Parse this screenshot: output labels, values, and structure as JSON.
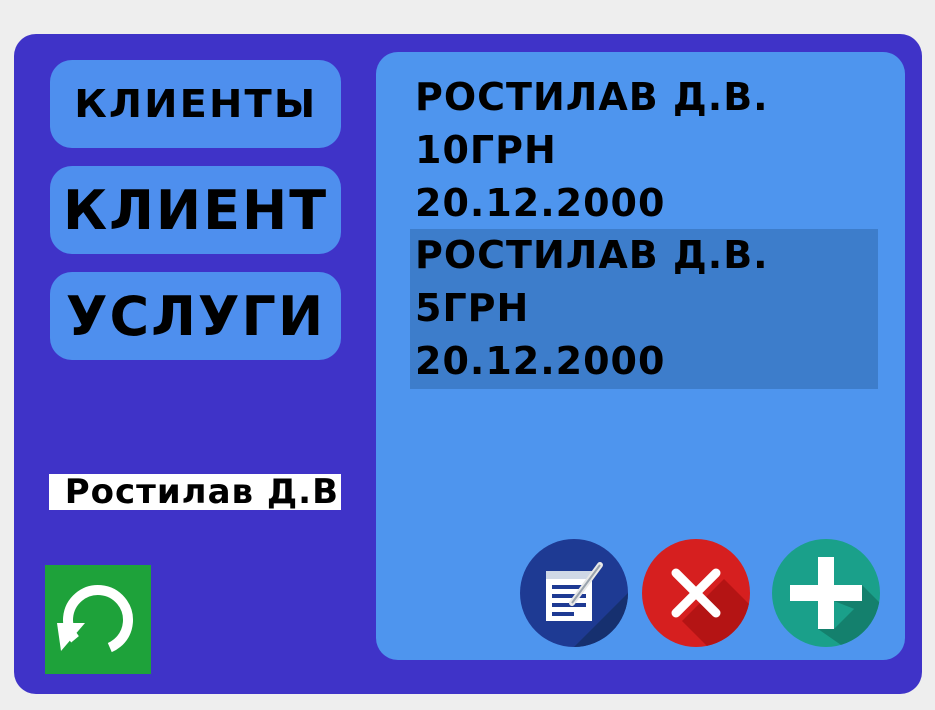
{
  "nav": {
    "clients_label": "КЛИЕНТЫ",
    "client_label": "КЛИЕНТ",
    "services_label": "УСЛУГИ"
  },
  "search": {
    "value": "Ростилав Д.В"
  },
  "records": [
    {
      "name": "РОСТИЛАВ Д.В.",
      "amount": "10ГРН",
      "date": "20.12.2000",
      "selected": false
    },
    {
      "name": "РОСТИЛАВ Д.В.",
      "amount": "5ГРН",
      "date": "20.12.2000",
      "selected": true
    }
  ],
  "icons": {
    "refresh": "refresh-icon",
    "edit": "edit-document-icon",
    "delete": "close-icon",
    "add": "plus-icon"
  },
  "colors": {
    "frame": "#3f33c8",
    "panel": "#4e95ee",
    "nav_button": "#4e8fee",
    "selected_row": "#3d7dcb",
    "refresh_button": "#1ea23a",
    "edit_button": "#1e3a93",
    "delete_button": "#d61f1f",
    "add_button": "#1aa08a"
  }
}
